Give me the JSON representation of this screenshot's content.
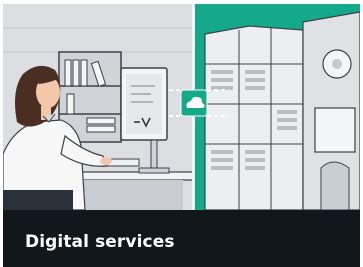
{
  "card": {
    "title": "Digital services",
    "icons": {
      "cloud": "cloud-icon"
    },
    "colors": {
      "office_background": "#dadcdf",
      "factory_background": "#14a98a",
      "caption_background": "#12171b",
      "caption_text": "#ffffff"
    }
  }
}
